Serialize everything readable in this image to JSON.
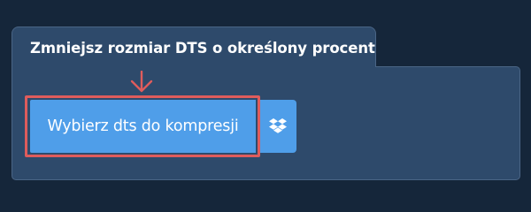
{
  "panel": {
    "title": "Zmniejsz rozmiar DTS o określony procent"
  },
  "upload": {
    "choose_button_label": "Wybierz dts do kompresji",
    "dropbox_icon": "dropbox-icon"
  },
  "colors": {
    "background": "#15263a",
    "panel": "#2e4a6b",
    "button": "#4f9ee9",
    "highlight": "#df5c5c"
  }
}
